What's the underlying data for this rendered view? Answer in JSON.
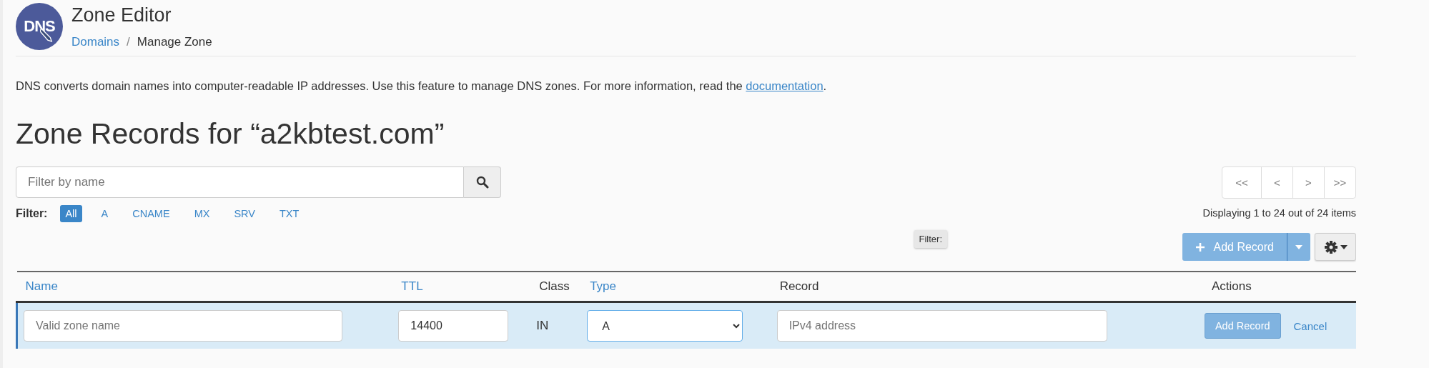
{
  "header": {
    "logo_text": "DNS",
    "title": "Zone Editor",
    "separator": "/",
    "breadcrumb": [
      {
        "label": "Domains",
        "kind": "link"
      },
      {
        "label": "Manage Zone",
        "kind": "current"
      }
    ]
  },
  "description": {
    "text": "DNS converts domain names into computer-readable IP addresses. Use this feature to manage DNS zones. For more information, read the ",
    "link": "documentation",
    "after": "."
  },
  "heading": "Zone Records for “a2kbtest.com”",
  "search": {
    "placeholder": "Filter by name"
  },
  "filter": {
    "label": "Filter:",
    "types": [
      {
        "label": "All",
        "selected": true
      },
      {
        "label": "A",
        "selected": false
      },
      {
        "label": "CNAME",
        "selected": false
      },
      {
        "label": "MX",
        "selected": false
      },
      {
        "label": "SRV",
        "selected": false
      },
      {
        "label": "TXT",
        "selected": false
      }
    ]
  },
  "pagination": {
    "buttons": [
      "<<",
      "<",
      ">",
      ">>"
    ],
    "summary": "Displaying 1 to 24 out of 24 items"
  },
  "tooltip": "Filter:",
  "toolbar": {
    "add_button": "Add Record"
  },
  "table": {
    "columns": [
      {
        "label": "Name",
        "sortable": true
      },
      {
        "label": "TTL",
        "sortable": true
      },
      {
        "label": "Class",
        "sortable": false
      },
      {
        "label": "Type",
        "sortable": true
      },
      {
        "label": "Record",
        "sortable": false
      },
      {
        "label": "Actions",
        "sortable": false
      }
    ],
    "new_row": {
      "name_placeholder": "Valid zone name",
      "ttl": "14400",
      "class": "IN",
      "type": "A",
      "record_placeholder": "IPv4 address",
      "save": "Add Record",
      "cancel": "Cancel"
    }
  }
}
